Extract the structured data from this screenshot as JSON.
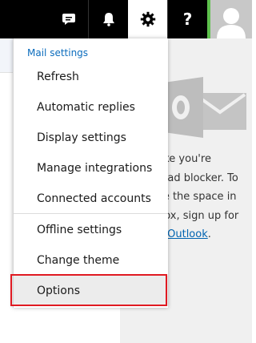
{
  "topbar": {
    "icons": {
      "chat": "chat-bubble-icon",
      "notifications": "bell-icon",
      "settings": "gear-icon",
      "help_label": "?",
      "account": "user-avatar-icon"
    },
    "colors": {
      "bar": "#000000",
      "presence": "#5ec14d"
    }
  },
  "menu": {
    "header": "Mail settings",
    "items": [
      {
        "label": "Refresh"
      },
      {
        "label": "Automatic replies"
      },
      {
        "label": "Display settings"
      },
      {
        "label": "Manage integrations"
      },
      {
        "label": "Connected accounts"
      },
      {
        "label": "Offline settings"
      },
      {
        "label": "Change theme"
      },
      {
        "label": "Options"
      }
    ],
    "selected": "Options",
    "highlight_color": "#e01a22"
  },
  "ad_panel": {
    "icon": "outlook-logo-icon",
    "lines": [
      "like you're",
      "n ad blocker. To",
      "ze the space in",
      "box, sign up for"
    ],
    "link_text": "e Outlook",
    "link_suffix": "."
  }
}
